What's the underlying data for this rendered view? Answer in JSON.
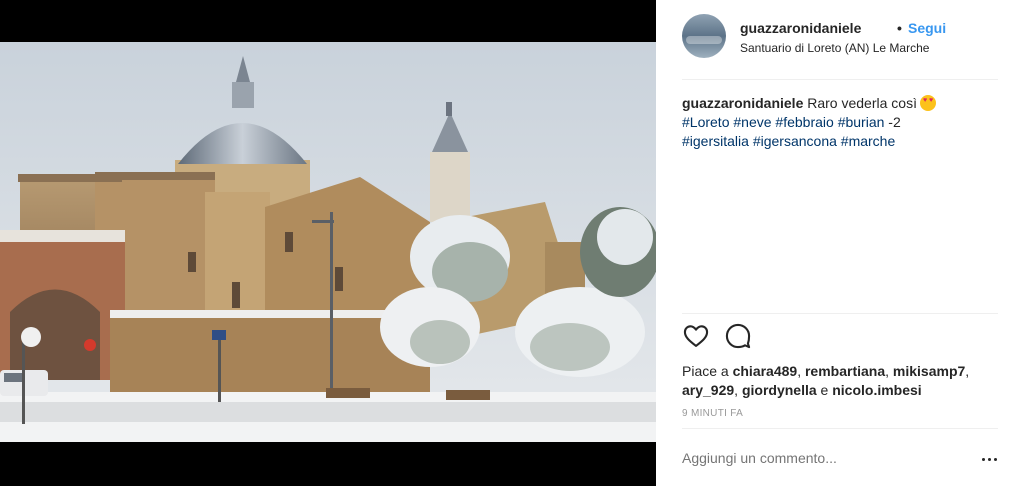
{
  "post": {
    "username": "guazzaronidaniele",
    "separator": "•",
    "follow_label": "Segui",
    "location": "Santuario di Loreto (AN) Le Marche"
  },
  "caption": {
    "username": "guazzaronidaniele",
    "text": "Raro vederla così",
    "emoji": "heart-eyes-emoji",
    "temperature": "-2",
    "hashtags": [
      "#Loreto",
      "#neve",
      "#febbraio",
      "#burian",
      "#igersitalia",
      "#igersancona",
      "#marche"
    ]
  },
  "actions": {
    "like_icon": "heart-icon",
    "comment_icon": "comment-icon"
  },
  "likes": {
    "prefix": "Piace a",
    "users": [
      "chiara489",
      "rembartiana",
      "mikisamp7",
      "ary_929",
      "giordynella",
      "nicolo.imbesi"
    ],
    "conjunction": "e"
  },
  "timestamp": "9 MINUTI FA",
  "comment_box": {
    "placeholder": "Aggiungi un commento...",
    "more_icon": "more-options-icon"
  },
  "colors": {
    "accent": "#3897f0",
    "hashtag": "#003569",
    "muted": "#999999",
    "text": "#262626"
  }
}
